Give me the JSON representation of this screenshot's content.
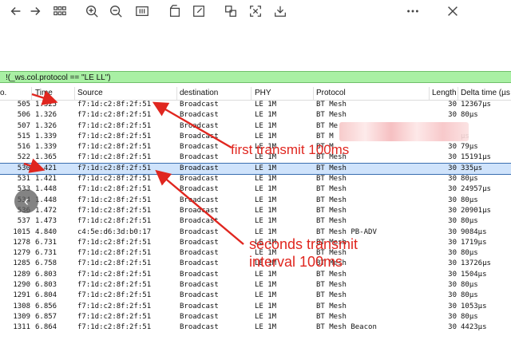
{
  "toolbar": {
    "icons": [
      "back-icon",
      "forward-icon",
      "grid-icon",
      "zoom-in-icon",
      "zoom-out-icon",
      "fit-icon",
      "rotate-icon",
      "edit-icon",
      "translate-icon",
      "scan-icon",
      "download-icon",
      "more-icon",
      "close-icon"
    ]
  },
  "filter": {
    "text": "!(_ws.col.protocol == \"LE LL\")"
  },
  "columns": {
    "no": "o.",
    "time": "Time",
    "source": "Source",
    "destination": "destination",
    "phy": "PHY",
    "protocol": "Protocol",
    "length": "Length",
    "delta": "Delta time (µs e"
  },
  "rows": [
    {
      "no": "505",
      "time": "1.325",
      "src": "f7:1d:c2:8f:2f:51",
      "dst": "Broadcast",
      "phy": "LE 1M",
      "prot": "BT Mesh",
      "len": "30",
      "delta": "12367µs"
    },
    {
      "no": "506",
      "time": "1.326",
      "src": "f7:1d:c2:8f:2f:51",
      "dst": "Broadcast",
      "phy": "LE 1M",
      "prot": "BT Mesh",
      "len": "30",
      "delta": "80µs"
    },
    {
      "no": "507",
      "time": "1.326",
      "src": "f7:1d:c2:8f:2f:51",
      "dst": "Broadcast",
      "phy": "LE 1M",
      "prot": "BT Me",
      "len": "",
      "delta": ""
    },
    {
      "no": "515",
      "time": "1.339",
      "src": "f7:1d:c2:8f:2f:51",
      "dst": "Broadcast",
      "phy": "LE 1M",
      "prot": "BT M",
      "len": "",
      "delta": "µs"
    },
    {
      "no": "516",
      "time": "1.339",
      "src": "f7:1d:c2:8f:2f:51",
      "dst": "Broadcast",
      "phy": "LE 1M",
      "prot": "BT M",
      "len": "30",
      "delta": "79µs"
    },
    {
      "no": "522",
      "time": "1.365",
      "src": "f7:1d:c2:8f:2f:51",
      "dst": "Broadcast",
      "phy": "LE 1M",
      "prot": "BT Mesh",
      "len": "30",
      "delta": "15191µs"
    },
    {
      "no": "530",
      "time": "1.421",
      "src": "f7:1d:c2:8f:2f:51",
      "dst": "Broadcast",
      "phy": "LE 1M",
      "prot": "BT Mesh",
      "len": "30",
      "delta": "335µs",
      "selected": true
    },
    {
      "no": "531",
      "time": "1.421",
      "src": "f7:1d:c2:8f:2f:51",
      "dst": "Broadcast",
      "phy": "LE 1M",
      "prot": "BT Mesh",
      "len": "30",
      "delta": "80µs"
    },
    {
      "no": "533",
      "time": "1.448",
      "src": "f7:1d:c2:8f:2f:51",
      "dst": "Broadcast",
      "phy": "LE 1M",
      "prot": "BT Mesh",
      "len": "30",
      "delta": "24957µs"
    },
    {
      "no": "534",
      "time": "1.448",
      "src": "f7:1d:c2:8f:2f:51",
      "dst": "Broadcast",
      "phy": "LE 1M",
      "prot": "BT Mesh",
      "len": "30",
      "delta": "80µs"
    },
    {
      "no": "536",
      "time": "1.472",
      "src": "f7:1d:c2:8f:2f:51",
      "dst": "Broadcast",
      "phy": "LE 1M",
      "prot": "BT Mesh",
      "len": "30",
      "delta": "20901µs"
    },
    {
      "no": "537",
      "time": "1.473",
      "src": "f7:1d:c2:8f:2f:51",
      "dst": "Broadcast",
      "phy": "LE 1M",
      "prot": "BT Mesh",
      "len": "30",
      "delta": "80µs"
    },
    {
      "no": "1015",
      "time": "4.840",
      "src": "c4:5e:d6:3d:b0:17",
      "dst": "Broadcast",
      "phy": "LE 1M",
      "prot": "BT Mesh PB-ADV",
      "len": "30",
      "delta": "9084µs"
    },
    {
      "no": "1278",
      "time": "6.731",
      "src": "f7:1d:c2:8f:2f:51",
      "dst": "Broadcast",
      "phy": "LE 1M",
      "prot": "BT Mesh",
      "len": "30",
      "delta": "1719µs"
    },
    {
      "no": "1279",
      "time": "6.731",
      "src": "f7:1d:c2:8f:2f:51",
      "dst": "Broadcast",
      "phy": "LE 1M",
      "prot": "BT Mesh",
      "len": "30",
      "delta": "80µs"
    },
    {
      "no": "1285",
      "time": "6.758",
      "src": "f7:1d:c2:8f:2f:51",
      "dst": "Broadcast",
      "phy": "LE 1M",
      "prot": "BT Mesh",
      "len": "30",
      "delta": "13726µs"
    },
    {
      "no": "1289",
      "time": "6.803",
      "src": "f7:1d:c2:8f:2f:51",
      "dst": "Broadcast",
      "phy": "LE 1M",
      "prot": "BT Mesh",
      "len": "30",
      "delta": "1504µs"
    },
    {
      "no": "1290",
      "time": "6.803",
      "src": "f7:1d:c2:8f:2f:51",
      "dst": "Broadcast",
      "phy": "LE 1M",
      "prot": "BT Mesh",
      "len": "30",
      "delta": "80µs"
    },
    {
      "no": "1291",
      "time": "6.804",
      "src": "f7:1d:c2:8f:2f:51",
      "dst": "Broadcast",
      "phy": "LE 1M",
      "prot": "BT Mesh",
      "len": "30",
      "delta": "80µs"
    },
    {
      "no": "1308",
      "time": "6.856",
      "src": "f7:1d:c2:8f:2f:51",
      "dst": "Broadcast",
      "phy": "LE 1M",
      "prot": "BT Mesh",
      "len": "30",
      "delta": "1053µs"
    },
    {
      "no": "1309",
      "time": "6.857",
      "src": "f7:1d:c2:8f:2f:51",
      "dst": "Broadcast",
      "phy": "LE 1M",
      "prot": "BT Mesh",
      "len": "30",
      "delta": "80µs"
    },
    {
      "no": "1311",
      "time": "6.864",
      "src": "f7:1d:c2:8f:2f:51",
      "dst": "Broadcast",
      "phy": "LE 1M",
      "prot": "BT Mesh Beacon",
      "len": "30",
      "delta": "4423µs"
    }
  ],
  "annotations": {
    "first": "first transmit 100ms",
    "second_line1": "seconds transmit",
    "second_line2": "interval 100ms",
    "color": "#e0261f"
  },
  "colors": {
    "filter_bg": "#a9f0a4",
    "selected_bg": "#cfe3fb"
  }
}
